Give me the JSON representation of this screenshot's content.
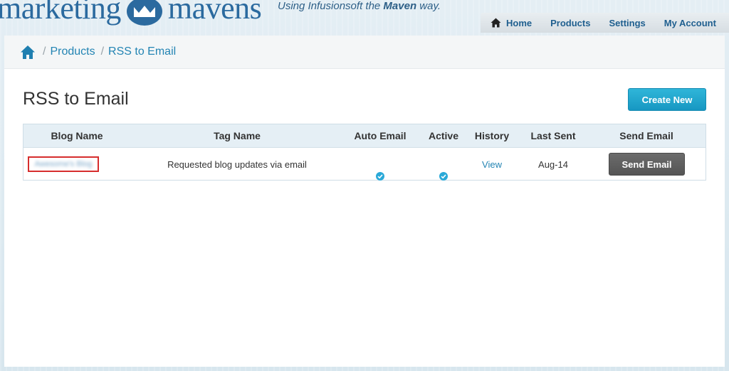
{
  "brand": {
    "logo_left": "marketing",
    "logo_right": "mavens",
    "tagline_pre": "Using Infusionsoft the ",
    "tagline_bold": "Maven",
    "tagline_post": " way."
  },
  "nav": {
    "home": "Home",
    "products": "Products",
    "settings": "Settings",
    "account": "My Account"
  },
  "breadcrumb": {
    "separator": "/",
    "products": "Products",
    "current": "RSS to Email"
  },
  "page": {
    "title": "RSS to Email",
    "create_button": "Create New"
  },
  "table": {
    "headers": {
      "blog_name": "Blog Name",
      "tag_name": "Tag Name",
      "auto_email": "Auto Email",
      "active": "Active",
      "history": "History",
      "last_sent": "Last Sent",
      "send_email": "Send Email"
    },
    "rows": [
      {
        "blog_name": "Awesome's Blog",
        "tag_name": "Requested blog updates via email",
        "auto_email": "checked",
        "active": "checked",
        "history": "View",
        "last_sent": "Aug-14",
        "send_button": "Send Email"
      }
    ]
  },
  "colors": {
    "accent": "#1f9fc9",
    "link": "#2384b3",
    "highlight_border": "#d62d2d",
    "send_button": "#5e5e5e"
  },
  "icons": {
    "home": "home-icon",
    "check": "check-circle-icon",
    "logo": "mavens-m-logo"
  }
}
